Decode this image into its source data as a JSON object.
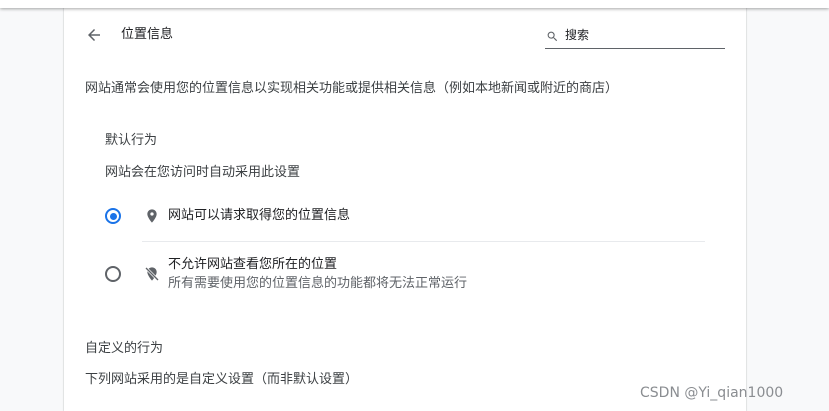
{
  "header": {
    "title": "位置信息",
    "search_placeholder": "搜索"
  },
  "description": "网站通常会使用您的位置信息以实现相关功能或提供相关信息（例如本地新闻或附近的商店）",
  "default_behavior": {
    "heading": "默认行为",
    "subtext": "网站会在您访问时自动采用此设置",
    "options": [
      {
        "label": "网站可以请求取得您的位置信息",
        "sublabel": "",
        "icon": "location-pin-icon",
        "selected": true
      },
      {
        "label": "不允许网站查看您所在的位置",
        "sublabel": "所有需要使用您的位置信息的功能都将无法正常运行",
        "icon": "location-off-icon",
        "selected": false
      }
    ]
  },
  "custom_behavior": {
    "heading": "自定义的行为",
    "subtext": "下列网站采用的是自定义设置（而非默认设置）"
  },
  "watermark": "CSDN @Yi_qian1000",
  "colors": {
    "accent": "#1a73e8",
    "text_primary": "#202124",
    "text_secondary": "#5f6368",
    "page_background": "#f8f9fa",
    "card_background": "#ffffff"
  }
}
